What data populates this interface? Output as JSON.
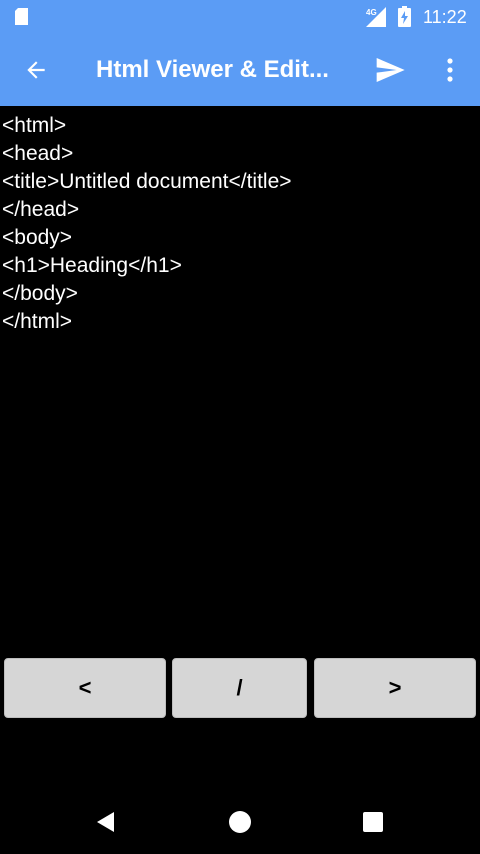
{
  "status_bar": {
    "time": "11:22",
    "network": "4G",
    "icons": [
      "sd-card-icon",
      "signal-icon",
      "battery-icon"
    ]
  },
  "app_bar": {
    "title": "Html Viewer & Edit...",
    "icons": [
      "back-arrow-icon",
      "send-icon",
      "overflow-menu-icon"
    ],
    "color": "#5b9cf5"
  },
  "editor": {
    "lines": [
      "<html>",
      "<head>",
      "<title>Untitled document</title>",
      "</head>",
      "<body>",
      "<h1>Heading</h1>",
      "</body>",
      "</html>"
    ]
  },
  "keys": {
    "left": "<",
    "slash": "/",
    "right": ">"
  },
  "nav_bar": {
    "icons": [
      "nav-back-icon",
      "nav-home-icon",
      "nav-recents-icon"
    ]
  }
}
